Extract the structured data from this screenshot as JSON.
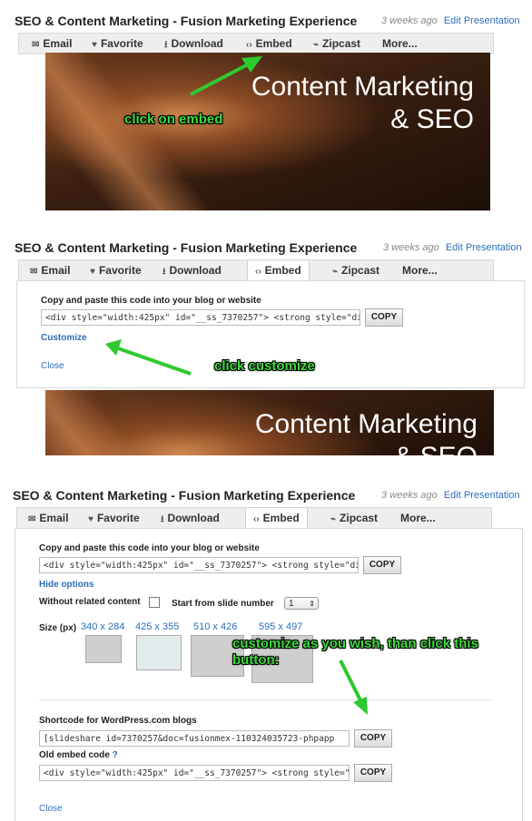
{
  "presentation": {
    "title": "SEO & Content Marketing - Fusion Marketing Experience",
    "ago": "3 weeks ago",
    "edit_link": "Edit Presentation"
  },
  "toolbar": {
    "email": "Email",
    "favorite": "Favorite",
    "download": "Download",
    "embed": "Embed",
    "zipcast": "Zipcast",
    "more": "More..."
  },
  "slide": {
    "line1": "Content Marketing",
    "line2": "& SEO"
  },
  "annotations": {
    "click_embed": "click on embed",
    "click_customize": "click customize",
    "customize_wish": "customize as you wish, than click this button:"
  },
  "embed": {
    "instruction": "Copy and paste this code into your blog or website",
    "code": "<div style=\"width:425px\" id=\"__ss_7370257\"> <strong style=\"disp",
    "copy": "COPY",
    "customize": "Customize",
    "close": "Close",
    "hide_options": "Hide options",
    "without_related": "Without related content",
    "start_from": "Start from slide number",
    "start_value": "1",
    "size_label": "Size (px)",
    "sizes": [
      "340 x 284",
      "425 x 355",
      "510 x 426",
      "595 x 497"
    ],
    "shortcode_label": "Shortcode for WordPress.com blogs",
    "shortcode": "[slideshare id=7370257&doc=fusionmex-110324035723-phpapp",
    "old_embed_label": "Old embed code",
    "old_embed_help": "?",
    "old_code": "<div style=\"width:425px\" id=\"__ss_7370257\"> <strong style=\"dis"
  },
  "colors": {
    "annotation_green": "#3ddc3d",
    "link_blue": "#2a6ebb",
    "arrow_green": "#2ec92e"
  }
}
